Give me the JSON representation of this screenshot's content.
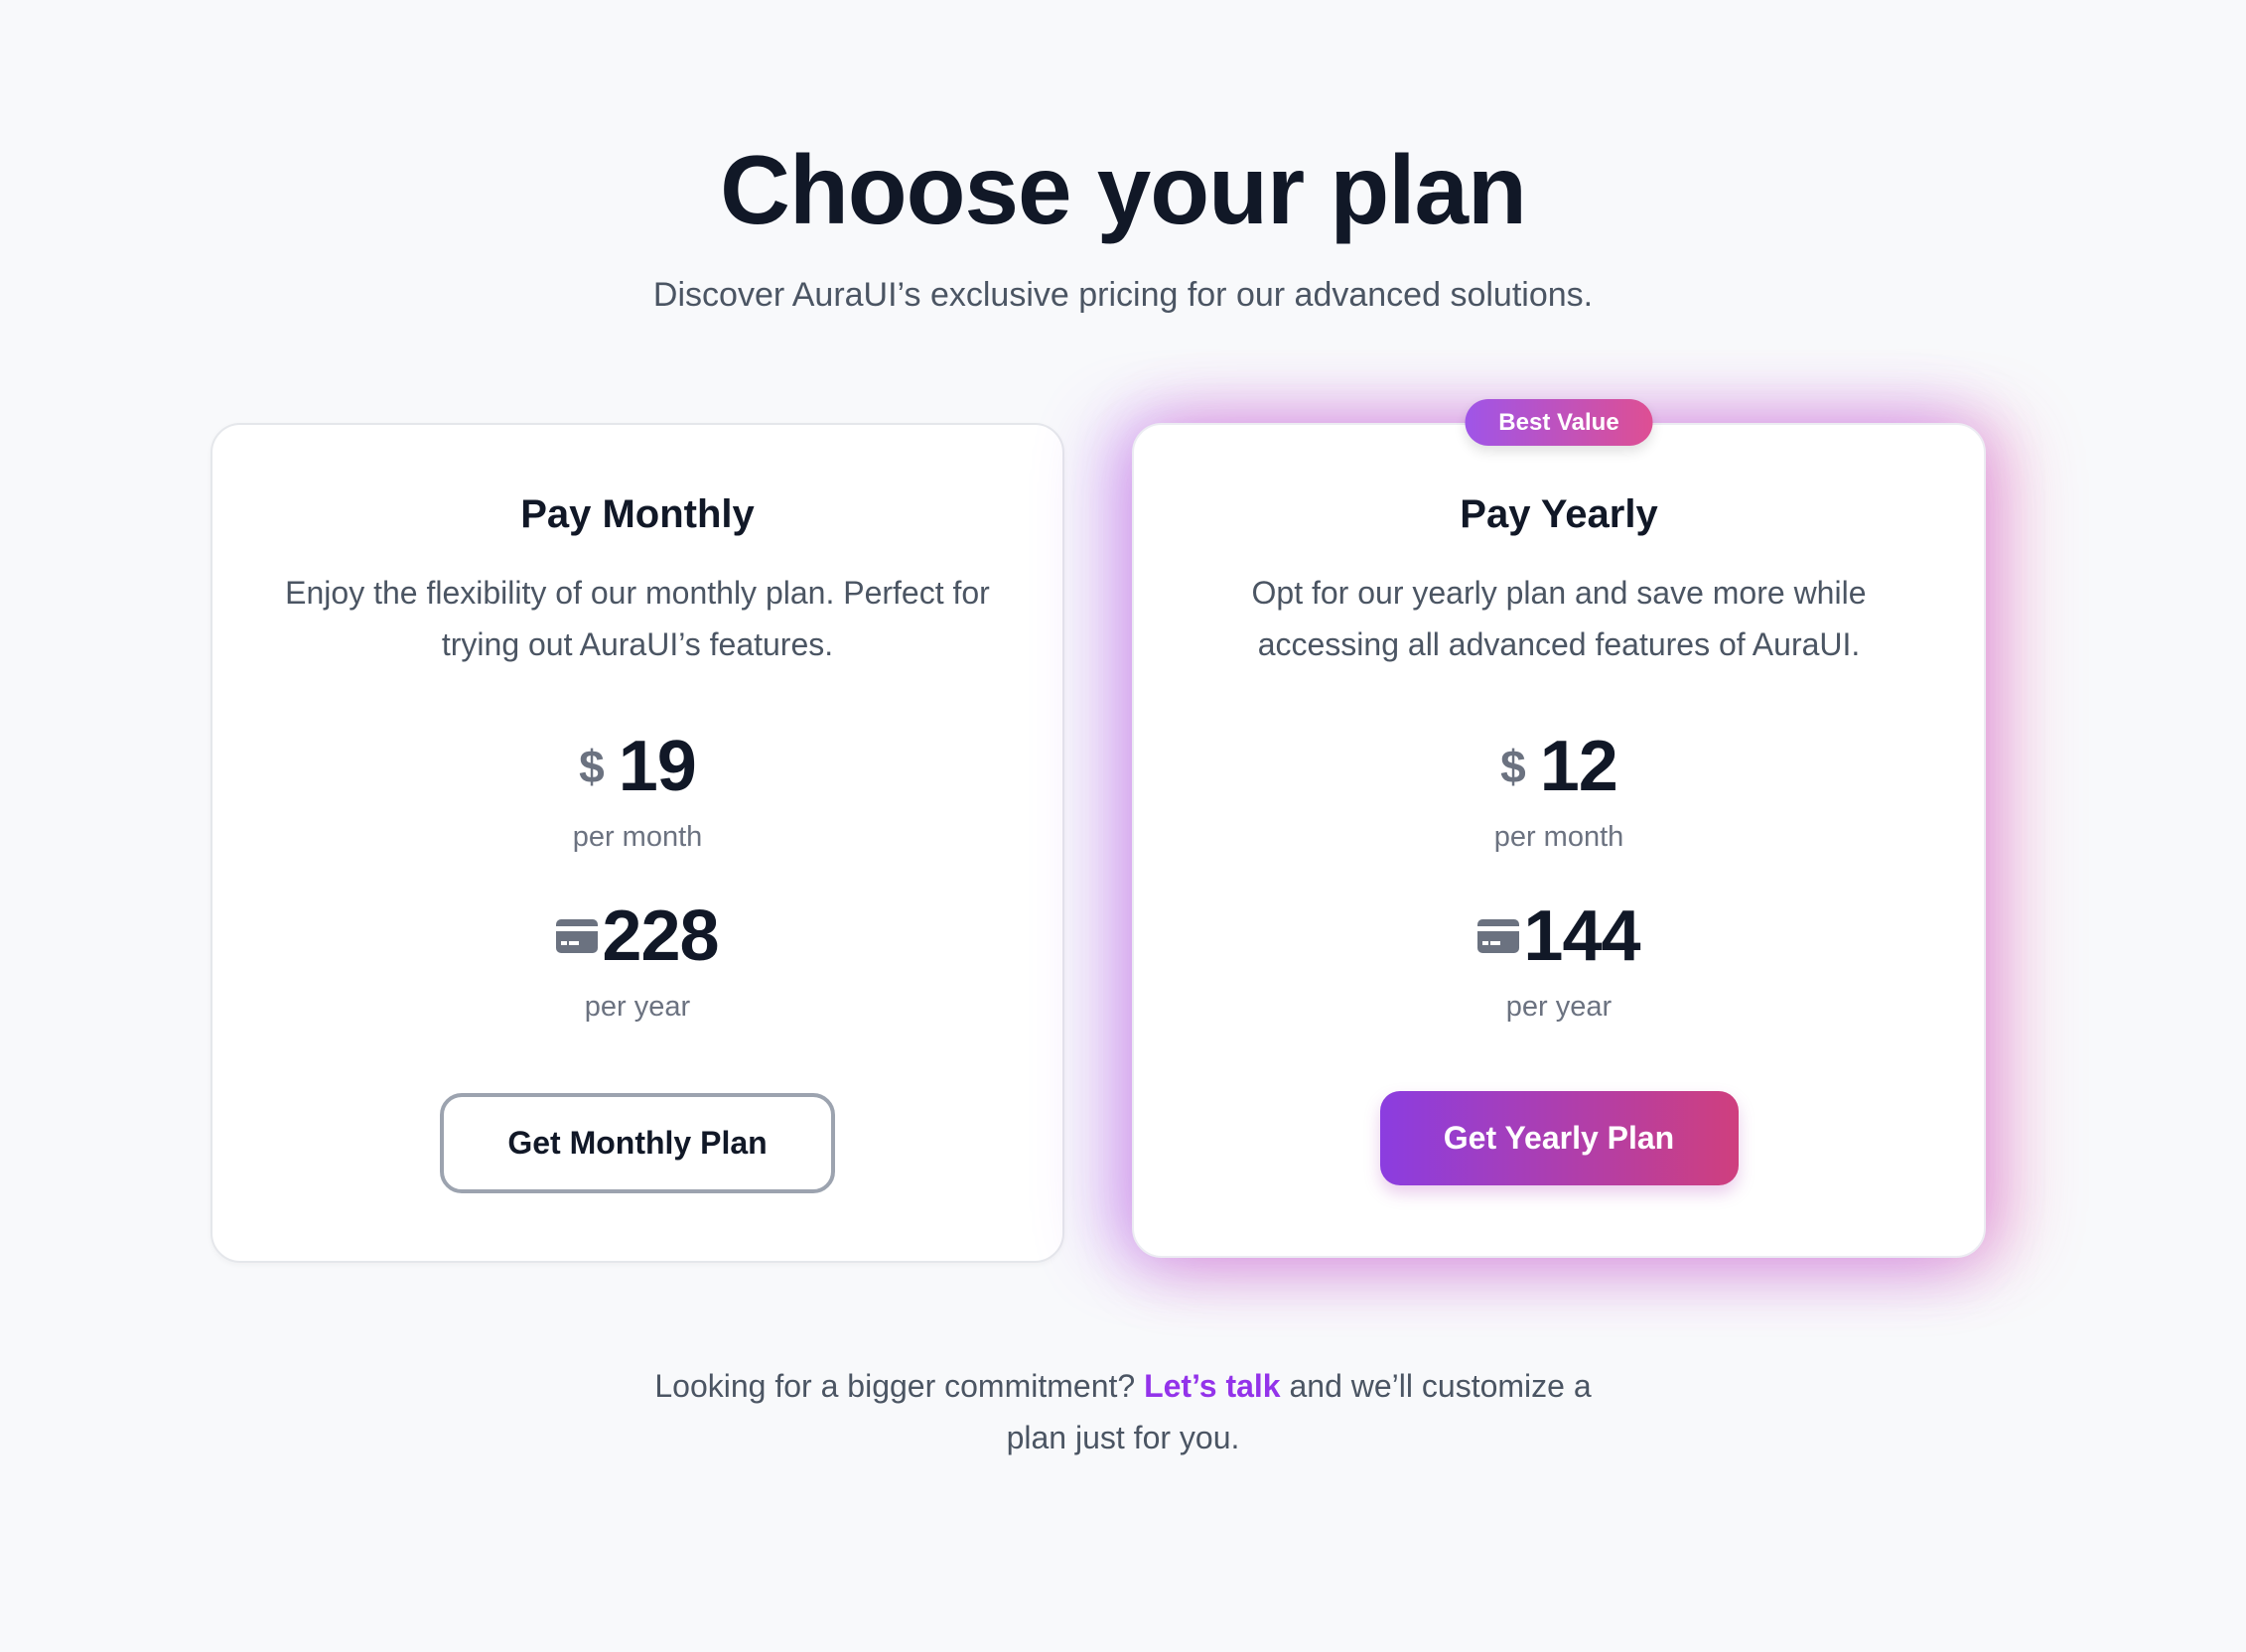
{
  "header": {
    "title": "Choose your plan",
    "subtitle": "Discover AuraUI’s exclusive pricing for our advanced solutions."
  },
  "plans": [
    {
      "title": "Pay Monthly",
      "description": "Enjoy the flexibility of our monthly plan. Perfect for trying out AuraUI’s features.",
      "currency": "$",
      "monthly_price": "19",
      "monthly_unit": "per month",
      "yearly_icon": "credit-card-icon",
      "yearly_price": "228",
      "yearly_unit": "per year",
      "button": "Get Monthly Plan"
    },
    {
      "badge": "Best Value",
      "title": "Pay Yearly",
      "description": "Opt for our yearly plan and save more while accessing all advanced features of AuraUI.",
      "currency": "$",
      "monthly_price": "12",
      "monthly_unit": "per month",
      "yearly_icon": "credit-card-icon",
      "yearly_price": "144",
      "yearly_unit": "per year",
      "button": "Get Yearly Plan"
    }
  ],
  "footer": {
    "before": "Looking for a bigger commitment? ",
    "link": "Let’s talk",
    "after": " and we’ll customize a plan just for you."
  },
  "colors": {
    "accent": "#9333ea",
    "gradient_start": "#8b3de0",
    "gradient_end": "#cf3f7e",
    "background": "#f8f9fb"
  }
}
